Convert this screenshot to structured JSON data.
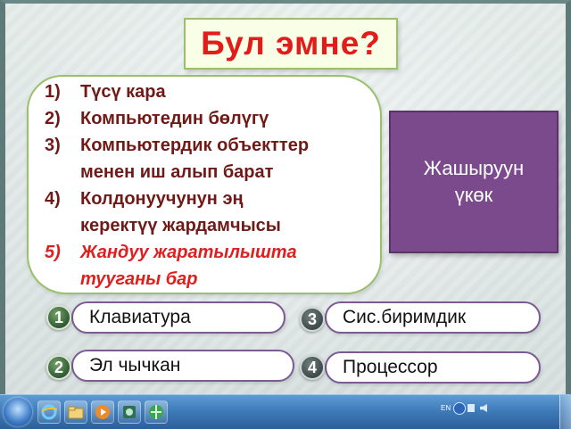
{
  "title": "Бул эмне?",
  "clues": [
    {
      "num": "1)",
      "text": "Түсү кара"
    },
    {
      "num": "2)",
      "text": "Компьютедин бөлүгү"
    },
    {
      "num": "3)",
      "text": "Компьютердик объекттер",
      "cont": "менен иш алып барат"
    },
    {
      "num": "4)",
      "text": "Колдонуучунун эң",
      "cont": "керектүү жардамчысы"
    },
    {
      "num": "5)",
      "text": "Жандуу жаратылышта",
      "cont": "тууганы бар",
      "color": "#e01e1e"
    }
  ],
  "hidden_answer": {
    "line1": "Жашыруун",
    "line2": "үкөк"
  },
  "answers": [
    {
      "number": "1",
      "label": "Клавиатура",
      "state": "opened"
    },
    {
      "number": "2",
      "label": "Эл чычкан",
      "state": "opened"
    },
    {
      "number": "3",
      "label": "Сис.биримдик",
      "state": "closed"
    },
    {
      "number": "4",
      "label": "Процессор",
      "state": "closed"
    }
  ],
  "taskbar": {
    "language": "EN",
    "icons": [
      "start-orb-icon",
      "internet-explorer-icon",
      "folder-icon",
      "media-player-icon",
      "app-icon",
      "browser-icon"
    ]
  },
  "colors": {
    "title_red": "#e21b1b",
    "clue_text": "#6f1a17",
    "clue_highlight": "#e01e1e",
    "hidden_box": "#7a4a8c",
    "answer_border": "#7b5b93",
    "green_border": "#9ac06a"
  }
}
